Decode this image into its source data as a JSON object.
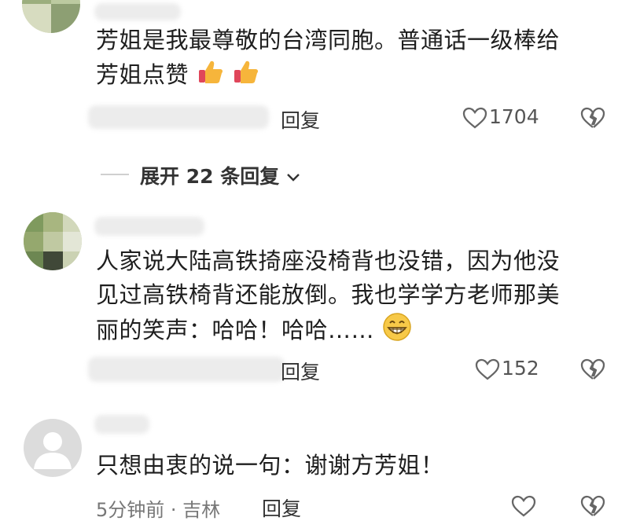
{
  "comments": [
    {
      "text_line1": "芳姐是我最尊敬的台湾同胞。普通话一级棒给",
      "text_line2": "芳姐点赞",
      "reply_label": "回复",
      "like_count": "1704"
    },
    {
      "text_line1": "人家说大陆高铁掎座没椅背也没错，因为他没",
      "text_line2": "见过高铁椅背还能放倒。我也学学方老师那美",
      "text_line3": "丽的笑声：哈哈！哈哈……",
      "reply_label": "回复",
      "like_count": "152"
    },
    {
      "text_line1": "只想由衷的说一句：谢谢方芳姐！",
      "time_location": "5分钟前 · 吉林",
      "reply_label": "回复",
      "like_count": ""
    }
  ],
  "expand_replies_label": "展开 22 条回复",
  "icons": {
    "like": "heart-outline-icon",
    "dislike": "broken-heart-icon",
    "thumbs_up": "thumbs-up-emoji",
    "grin": "grinning-emoji",
    "chevron": "chevron-down-icon",
    "default_avatar": "default-avatar-icon"
  }
}
